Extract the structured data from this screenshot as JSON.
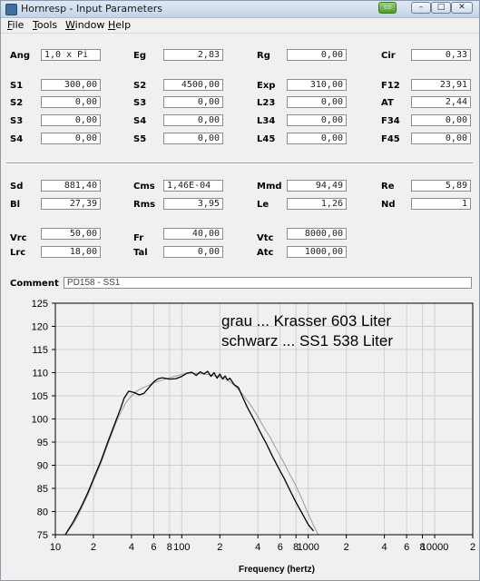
{
  "window": {
    "title": "Hornresp - Input Parameters",
    "buttons": [
      "▭",
      "–",
      "□",
      "✕"
    ]
  },
  "menu": [
    {
      "accel": "F",
      "rest": "ile"
    },
    {
      "accel": "T",
      "rest": "ools"
    },
    {
      "accel": "W",
      "rest": "indow"
    },
    {
      "accel": "H",
      "rest": "elp"
    }
  ],
  "params": {
    "ang": {
      "label": "Ang",
      "value": "1,0 x Pi"
    },
    "eg": {
      "label": "Eg",
      "value": "2,83"
    },
    "rg": {
      "label": "Rg",
      "value": "0,00"
    },
    "cir": {
      "label": "Cir",
      "value": "0,33"
    },
    "s1": {
      "label": "S1",
      "value": "300,00"
    },
    "s2a": {
      "label": "S2",
      "value": "4500,00"
    },
    "exp": {
      "label": "Exp",
      "value": "310,00"
    },
    "f12": {
      "label": "F12",
      "value": "23,91"
    },
    "s2": {
      "label": "S2",
      "value": "0,00"
    },
    "s3a": {
      "label": "S3",
      "value": "0,00"
    },
    "l23": {
      "label": "L23",
      "value": "0,00"
    },
    "at": {
      "label": "AT",
      "value": "2,44"
    },
    "s3": {
      "label": "S3",
      "value": "0,00"
    },
    "s4a": {
      "label": "S4",
      "value": "0,00"
    },
    "l34": {
      "label": "L34",
      "value": "0,00"
    },
    "f34": {
      "label": "F34",
      "value": "0,00"
    },
    "s4": {
      "label": "S4",
      "value": "0,00"
    },
    "s5": {
      "label": "S5",
      "value": "0,00"
    },
    "l45": {
      "label": "L45",
      "value": "0,00"
    },
    "f45": {
      "label": "F45",
      "value": "0,00"
    },
    "sd": {
      "label": "Sd",
      "value": "881,40"
    },
    "cms": {
      "label": "Cms",
      "value": "1,46E-04"
    },
    "mmd": {
      "label": "Mmd",
      "value": "94,49"
    },
    "re": {
      "label": "Re",
      "value": "5,89"
    },
    "bl": {
      "label": "Bl",
      "value": "27,39"
    },
    "rms": {
      "label": "Rms",
      "value": "3,95"
    },
    "le": {
      "label": "Le",
      "value": "1,26"
    },
    "nd": {
      "label": "Nd",
      "value": "1"
    },
    "vrc": {
      "label": "Vrc",
      "value": "50,00"
    },
    "fr": {
      "label": "Fr",
      "value": "40,00"
    },
    "vtc": {
      "label": "Vtc",
      "value": "8000,00"
    },
    "lrc": {
      "label": "Lrc",
      "value": "18,00"
    },
    "tal": {
      "label": "Tal",
      "value": "0,00"
    },
    "atc": {
      "label": "Atc",
      "value": "1000,00"
    }
  },
  "comment": {
    "label": "Comment",
    "value": "PD158 - SS1"
  },
  "chart_data": {
    "type": "line",
    "xlabel": "Frequency (hertz)",
    "x_scale": "log",
    "xlim": [
      10,
      20000
    ],
    "ylim": [
      75,
      125
    ],
    "x_tick_labels": [
      "10",
      "2",
      "4",
      "6",
      "8",
      "100",
      "2",
      "4",
      "6",
      "8",
      "1000",
      "2",
      "4",
      "6",
      "8",
      "10000",
      "2"
    ],
    "y_tick_labels": [
      "75",
      "80",
      "85",
      "90",
      "95",
      "100",
      "105",
      "110",
      "115",
      "120",
      "125"
    ],
    "grid": true,
    "annotations": [
      "grau ... Krasser 603 Liter",
      "schwarz ... SS1 538 Liter"
    ],
    "series": [
      {
        "color": "#000000",
        "x": [
          12,
          14,
          16,
          18,
          20,
          23,
          26,
          30,
          33,
          35,
          38,
          42,
          46,
          50,
          55,
          60,
          65,
          70,
          80,
          90,
          100,
          110,
          120,
          130,
          140,
          150,
          160,
          170,
          180,
          190,
          200,
          210,
          220,
          230,
          240,
          250,
          260,
          280,
          300,
          330,
          370,
          420,
          470,
          520,
          580,
          650,
          720,
          800,
          900,
          1000,
          1100,
          1200
        ],
        "y": [
          75,
          78,
          81,
          84,
          87,
          91,
          95,
          99.5,
          102.5,
          104.5,
          106,
          105.7,
          105.2,
          105.5,
          106.8,
          108,
          108.7,
          108.9,
          108.6,
          108.7,
          109.2,
          109.9,
          110.1,
          109.4,
          110.2,
          109.7,
          110.3,
          109.2,
          110,
          108.8,
          109.7,
          108.6,
          109.3,
          108.4,
          108.8,
          108.1,
          107.4,
          106.8,
          105,
          102.5,
          100,
          97,
          94.5,
          92,
          89.5,
          87,
          84.5,
          82,
          79.5,
          77.2,
          75.8,
          74.5
        ]
      },
      {
        "color": "#9a9a9a",
        "x": [
          12,
          14,
          16,
          18,
          20,
          23,
          26,
          30,
          33,
          36,
          40,
          45,
          50,
          55,
          60,
          70,
          80,
          90,
          100,
          110,
          120,
          130,
          140,
          150,
          170,
          200,
          230,
          260,
          300,
          350,
          400,
          450,
          500,
          560,
          630,
          700,
          800,
          900,
          1000,
          1100,
          1200
        ],
        "y": [
          75,
          77.5,
          80.5,
          83.5,
          86.5,
          90.5,
          94.5,
          99,
          101.5,
          103.5,
          105,
          106.2,
          106.8,
          107.3,
          107.8,
          108.4,
          108.9,
          109.3,
          109.6,
          109.8,
          109.9,
          109.8,
          109.8,
          109.7,
          109.5,
          109.1,
          108.4,
          107.3,
          105.5,
          103,
          100.5,
          98,
          96,
          93.5,
          91,
          88.5,
          85.5,
          82.5,
          79.5,
          77,
          75
        ]
      }
    ]
  }
}
